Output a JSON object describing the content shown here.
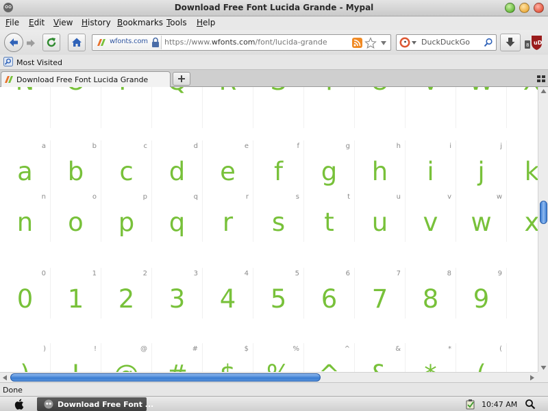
{
  "window": {
    "title": "Download Free Font Lucida Grande - Mypal"
  },
  "menubar": {
    "items": [
      "File",
      "Edit",
      "View",
      "History",
      "Bookmarks",
      "Tools",
      "Help"
    ]
  },
  "navbar": {
    "site_domain": "wfonts.com",
    "url_prefix": "https://www.",
    "url_host": "wfonts.com",
    "url_path": "/font/lucida-grande",
    "search_placeholder": "DuckDuckGo"
  },
  "bookmarks": {
    "most_visited": "Most Visited"
  },
  "tabs": {
    "active_label": "Download Free Font Lucida Grande"
  },
  "glyph_rows": [
    {
      "small": [
        "",
        "",
        "",
        "",
        "",
        "",
        "",
        "",
        "",
        "",
        "",
        ""
      ],
      "big": [
        "N",
        "O",
        "P",
        "Q",
        "R",
        "S",
        "T",
        "U",
        "V",
        "W",
        "X"
      ]
    },
    {
      "small": [
        "a",
        "b",
        "c",
        "d",
        "e",
        "f",
        "g",
        "h",
        "i",
        "j",
        ""
      ],
      "big": [
        "a",
        "b",
        "c",
        "d",
        "e",
        "f",
        "g",
        "h",
        "i",
        "j",
        "k"
      ]
    },
    {
      "small": [
        "n",
        "o",
        "p",
        "q",
        "r",
        "s",
        "t",
        "u",
        "v",
        "w",
        ""
      ],
      "big": [
        "n",
        "o",
        "p",
        "q",
        "r",
        "s",
        "t",
        "u",
        "v",
        "w",
        "x"
      ]
    },
    {
      "small": [
        "0",
        "1",
        "2",
        "3",
        "4",
        "5",
        "6",
        "7",
        "8",
        "9",
        ""
      ],
      "big": [
        "0",
        "1",
        "2",
        "3",
        "4",
        "5",
        "6",
        "7",
        "8",
        "9",
        ""
      ]
    },
    {
      "small": [
        ")",
        "!",
        "@",
        "#",
        "$",
        "%",
        "^",
        "&",
        "*",
        "(",
        ""
      ],
      "big": [
        ")",
        "!",
        "@",
        "#",
        "$",
        "%",
        "^",
        "&",
        "*",
        "(",
        ""
      ]
    }
  ],
  "status": {
    "text": "Done"
  },
  "taskbar": {
    "task_label": "Download Free Font ...",
    "clock": "10:47 AM"
  },
  "colors": {
    "glyph": "#78c13a",
    "accent": "#3a7cd2"
  }
}
